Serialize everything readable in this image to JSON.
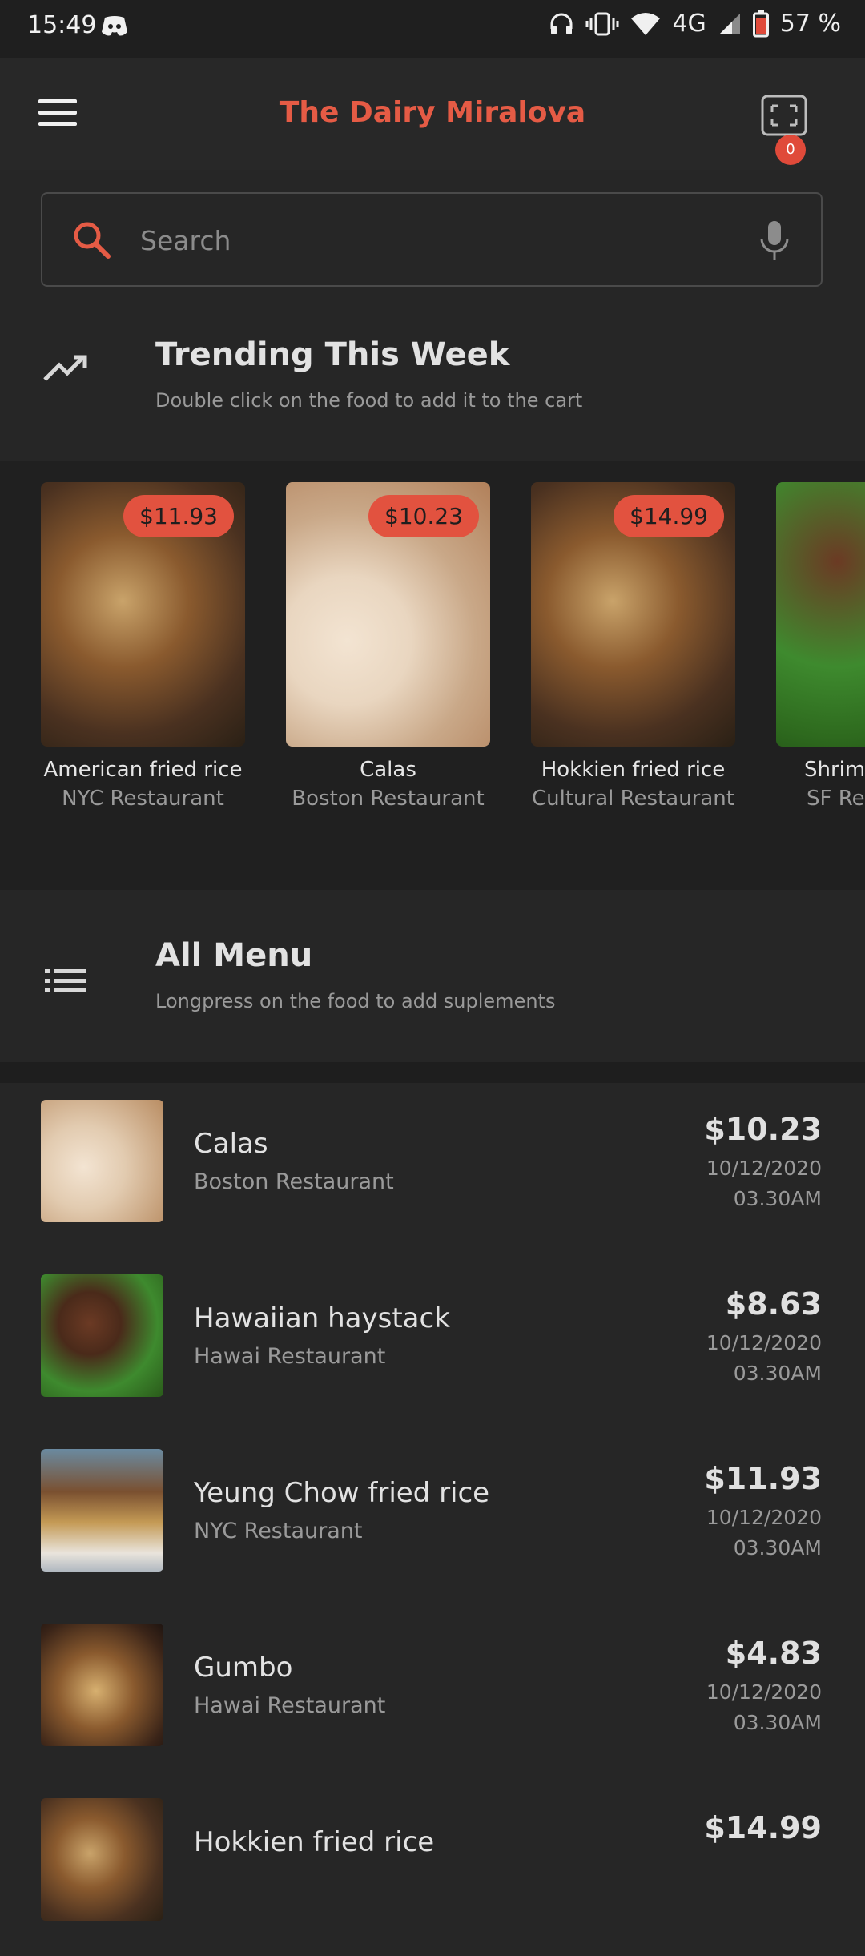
{
  "status_bar": {
    "time": "15:49",
    "network": "4G",
    "battery": "57 %"
  },
  "app": {
    "title": "The Dairy Miralova",
    "cart_count": "0",
    "accent": "#e55b45"
  },
  "search": {
    "placeholder": "Search"
  },
  "trending": {
    "title": "Trending This Week",
    "subtitle": "Double click on the food to add it to the cart",
    "items": [
      {
        "price": "$11.93",
        "name": "American fried rice",
        "restaurant": "NYC Restaurant"
      },
      {
        "price": "$10.23",
        "name": "Calas",
        "restaurant": "Boston Restaurant"
      },
      {
        "price": "$14.99",
        "name": "Hokkien fried rice",
        "restaurant": "Cultural Restaurant"
      },
      {
        "price": "",
        "name": "Shrim",
        "restaurant": "SF Res"
      }
    ]
  },
  "all_menu": {
    "title": "All Menu",
    "subtitle": "Longpress on the food to add suplements",
    "items": [
      {
        "name": "Calas",
        "restaurant": "Boston Restaurant",
        "price": "$10.23",
        "date": "10/12/2020",
        "time": "03.30AM"
      },
      {
        "name": "Hawaiian haystack",
        "restaurant": "Hawai Restaurant",
        "price": "$8.63",
        "date": "10/12/2020",
        "time": "03.30AM"
      },
      {
        "name": "Yeung Chow fried rice",
        "restaurant": "NYC Restaurant",
        "price": "$11.93",
        "date": "10/12/2020",
        "time": "03.30AM"
      },
      {
        "name": "Gumbo",
        "restaurant": "Hawai Restaurant",
        "price": "$4.83",
        "date": "10/12/2020",
        "time": "03.30AM"
      },
      {
        "name": "Hokkien fried rice",
        "restaurant": "",
        "price": "$14.99",
        "date": "",
        "time": ""
      }
    ]
  }
}
